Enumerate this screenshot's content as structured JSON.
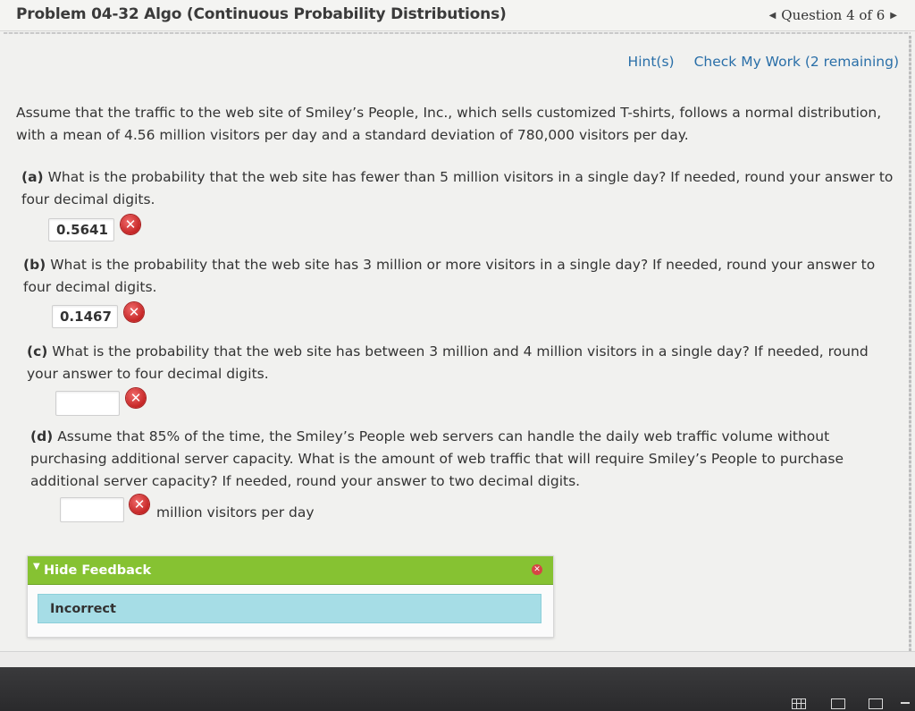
{
  "header": {
    "title": "Problem 04-32 Algo (Continuous Probability Distributions)",
    "question_nav": "Question 4 of 6",
    "prev_arrow": "◀",
    "next_arrow": "▶"
  },
  "hintbar": {
    "hints": "Hint(s)",
    "check": "Check My Work (2 remaining)"
  },
  "intro": "Assume that the traffic to the web site of Smiley’s People, Inc., which sells customized T-shirts, follows a normal distribution, with a mean of 4.56 million visitors per day and a standard deviation of 780,000 visitors per day.",
  "parts": [
    {
      "label": "(a)",
      "question": "What is the probability that the web site has fewer than 5 million visitors in a single day? If needed, round your answer to four decimal digits.",
      "answer": "0.5641",
      "status": "incorrect"
    },
    {
      "label": "(b)",
      "question": "What is the probability that the web site has 3 million or more visitors in a single day? If needed, round your answer to four decimal digits.",
      "answer": "0.1467",
      "status": "incorrect"
    },
    {
      "label": "(c)",
      "question": "What is the probability that the web site has between 3 million and 4 million visitors in a single day? If needed, round your answer to four decimal digits.",
      "answer": "",
      "status": "incorrect"
    },
    {
      "label": "(d)",
      "question": "Assume that 85% of the time, the Smiley’s People web servers can handle the daily web traffic volume without purchasing additional server capacity. What is the amount of web traffic that will require Smiley’s People to purchase additional server capacity? If needed, round your answer to two decimal digits.",
      "answer": "",
      "status": "incorrect",
      "unit": "million visitors per day"
    }
  ],
  "feedback": {
    "toggle_icon": "▼",
    "title": "Hide Feedback",
    "message": "Incorrect"
  },
  "icons": {
    "error": "✕",
    "close": "✕"
  },
  "colors": {
    "link": "#2a6fa8",
    "feedback_header": "#86c232",
    "feedback_message": "#a6dde6",
    "error": "#c52525"
  }
}
